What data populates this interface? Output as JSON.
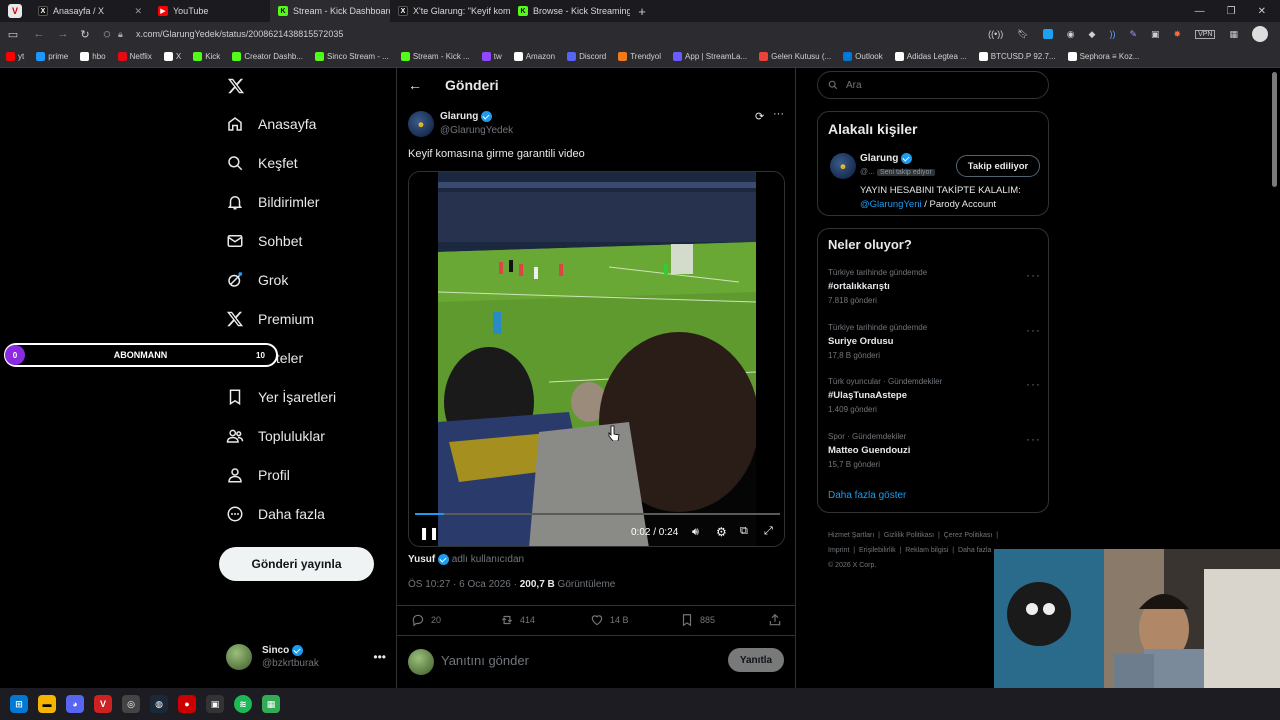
{
  "browser": {
    "tabs": [
      {
        "label": "Anasayfa / X",
        "color": "#ffffff",
        "glyph": "X"
      },
      {
        "label": "YouTube",
        "color": "#ff0000",
        "glyph": "▶"
      },
      {
        "label": "Stream - Kick Dashboard",
        "color": "#53fc18",
        "glyph": "K"
      },
      {
        "label": "X'te Glarung: \"Keyif komas",
        "color": "#ffffff",
        "glyph": "X"
      },
      {
        "label": "Browse - Kick Streaming",
        "color": "#53fc18",
        "glyph": "K"
      }
    ],
    "url": "x.com/GlarungYedek/status/2008621438815572035",
    "bookmarks": [
      {
        "label": "yt",
        "color": "#ff0000"
      },
      {
        "label": "prime",
        "color": "#1a98ff"
      },
      {
        "label": "hbo",
        "color": "#ffffff"
      },
      {
        "label": "Netflix",
        "color": "#e50914"
      },
      {
        "label": "X",
        "color": "#ffffff"
      },
      {
        "label": "Kick",
        "color": "#53fc18"
      },
      {
        "label": "Creator Dashb...",
        "color": "#53fc18"
      },
      {
        "label": "Sinco Stream - ...",
        "color": "#53fc18"
      },
      {
        "label": "Stream - Kick ...",
        "color": "#53fc18"
      },
      {
        "label": "tw",
        "color": "#9146ff"
      },
      {
        "label": "Amazon",
        "color": "#ffffff"
      },
      {
        "label": "Discord",
        "color": "#5865f2"
      },
      {
        "label": "Trendyol",
        "color": "#f27a1a"
      },
      {
        "label": "App | StreamLa...",
        "color": "#6a5cff"
      },
      {
        "label": "Gelen Kutusu (...",
        "color": "#ea4335"
      },
      {
        "label": "Outlook",
        "color": "#0078d4"
      },
      {
        "label": "Adidas Legtea ...",
        "color": "#ffffff"
      },
      {
        "label": "BTCUSD.P 92.7...",
        "color": "#ffffff"
      },
      {
        "label": "Sephora ≡ Koz...",
        "color": "#ffffff"
      }
    ]
  },
  "nav": {
    "items": [
      {
        "label": "Anasayfa",
        "icon": "home-icon"
      },
      {
        "label": "Keşfet",
        "icon": "search-icon"
      },
      {
        "label": "Bildirimler",
        "icon": "bell-icon"
      },
      {
        "label": "Sohbet",
        "icon": "envelope-icon"
      },
      {
        "label": "Grok",
        "icon": "grok-icon"
      },
      {
        "label": "Premium",
        "icon": "x-logo-icon"
      },
      {
        "label": "Listeler",
        "icon": "list-icon"
      },
      {
        "label": "Yer İşaretleri",
        "icon": "bookmark-icon"
      },
      {
        "label": "Topluluklar",
        "icon": "people-icon"
      },
      {
        "label": "Profil",
        "icon": "person-icon"
      },
      {
        "label": "Daha fazla",
        "icon": "more-circle-icon"
      }
    ],
    "post_button": "Gönderi yayınla",
    "account": {
      "name": "Sinco",
      "handle": "@bzkrtburak"
    }
  },
  "overlay": {
    "left_value": "0",
    "label": "ABONMANN",
    "right_value": "10"
  },
  "post": {
    "header_title": "Gönderi",
    "author_name": "Glarung",
    "author_handle": "@GlarungYedek",
    "text": "Keyif komasına girme garantili video",
    "video": {
      "time": "0:02 / 0:24",
      "progress": 0.08
    },
    "attribution_name": "Yusuf",
    "attribution_suffix": "adlı kullanıcıdan",
    "meta_time": "ÖS 10:27 · 6 Oca 2026 · ",
    "meta_views_count": "200,7 B",
    "meta_views_label": " Görüntüleme",
    "actions": {
      "replies": "20",
      "reposts": "414",
      "likes": "14 B",
      "bookmarks": "885"
    },
    "reply_placeholder": "Yanıtını gönder",
    "reply_button": "Yanıtla"
  },
  "sidebar": {
    "search_placeholder": "Ara",
    "related": {
      "title": "Alakalı kişiler",
      "name": "Glarung",
      "handle": "@...",
      "follows_you": "Seni takip ediyor",
      "follow_button": "Takip ediliyor",
      "bio_line1": "YAYIN HESABINI TAKİPTE KALALIM:",
      "bio_link": "@GlarungYeni",
      "bio_rest": " / Parody Account"
    },
    "trends": {
      "title": "Neler oluyor?",
      "items": [
        {
          "context": "Türkiye tarihinde gündemde",
          "name": "#ortalıkkarıştı",
          "count": "7.818 gönderi"
        },
        {
          "context": "Türkiye tarihinde gündemde",
          "name": "Suriye Ordusu",
          "count": "17,8 B gönderi"
        },
        {
          "context": "Türk oyuncular · Gündemdekiler",
          "name": "#UlaşTunaAstepe",
          "count": "1.409 gönderi"
        },
        {
          "context": "Spor · Gündemdekiler",
          "name": "Matteo Guendouzi",
          "count": "15,7 B gönderi"
        }
      ],
      "show_more": "Daha fazla göster"
    },
    "footer": {
      "line1": [
        "Hizmet Şartları",
        "Gizlilik Politikası",
        "Çerez Politikası"
      ],
      "line2": [
        "Imprint",
        "Erişilebilirlik",
        "Reklam bilgisi",
        "Daha fazla ..."
      ],
      "copyright": "© 2026 X Corp."
    }
  }
}
